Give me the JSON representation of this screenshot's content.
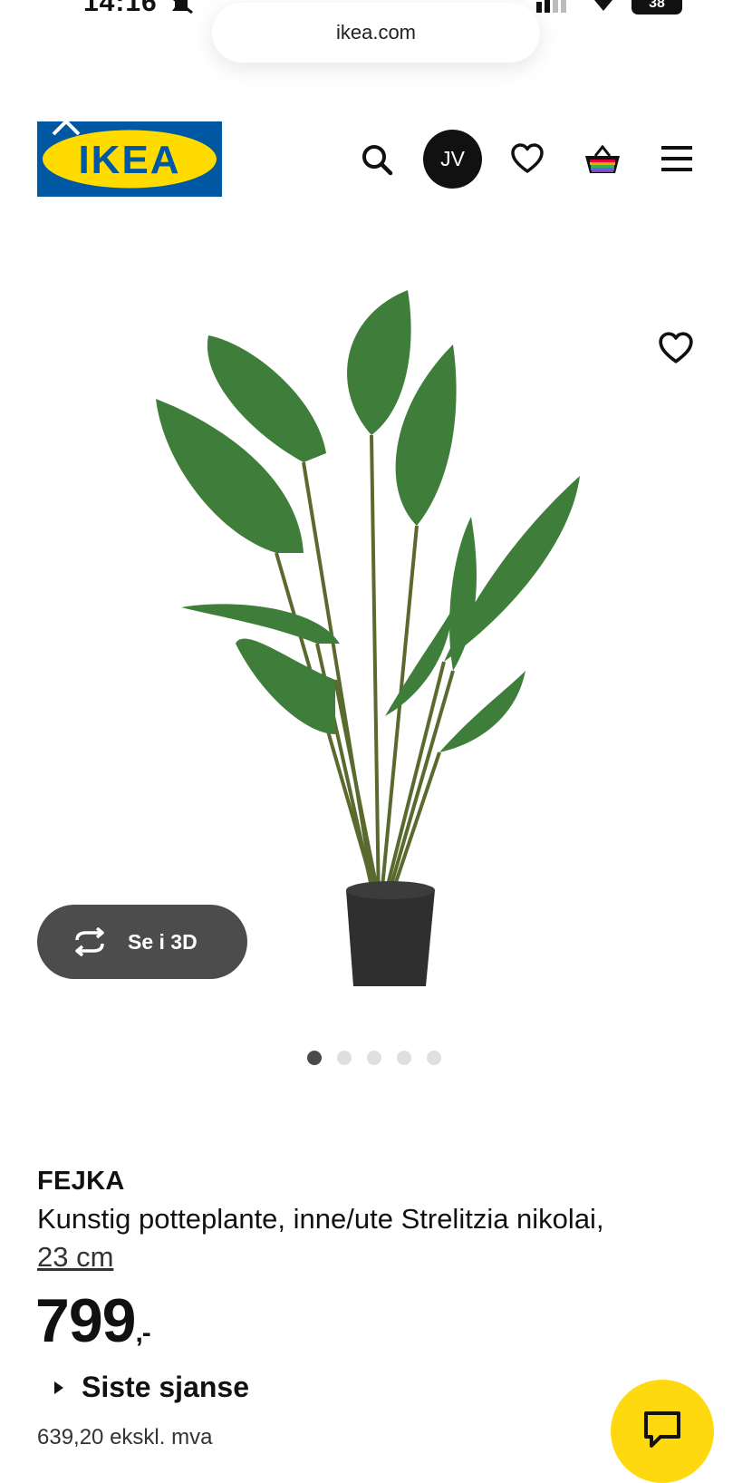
{
  "status_bar": {
    "time": "14:16",
    "battery": "38"
  },
  "browser": {
    "url": "ikea.com"
  },
  "header": {
    "logo_text": "IKEA",
    "avatar_initials": "JV"
  },
  "product": {
    "carousel": {
      "total_images": 5,
      "active_index": 0,
      "view_3d_label": "Se i 3D"
    },
    "name": "FEJKA",
    "description": "Kunstig potteplante, inne/ute Strelitzia nikolai,",
    "size": "23 cm",
    "price": "799",
    "price_suffix": ",-",
    "last_chance": "Siste sjanse",
    "price_ex_vat": "639,20 ekskl. mva"
  },
  "colors": {
    "ikea_blue": "#0058a3",
    "ikea_yellow": "#ffdb00",
    "chat_yellow": "#ffd910",
    "button_gray": "#4c4c4c"
  }
}
